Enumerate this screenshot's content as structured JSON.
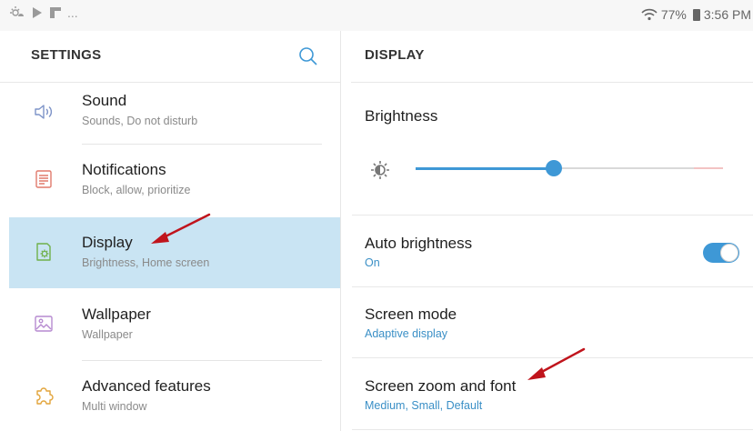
{
  "status_bar": {
    "left_icons": [
      "weather-icon",
      "play-store-icon",
      "flipboard-icon"
    ],
    "overflow": "...",
    "battery_percent": "77%",
    "time": "3:56 PM"
  },
  "left_panel": {
    "title": "SETTINGS",
    "items": [
      {
        "label": "Sound",
        "subtitle": "Sounds, Do not disturb",
        "icon": "speaker-icon"
      },
      {
        "label": "Notifications",
        "subtitle": "Block, allow, prioritize",
        "icon": "notifications-icon"
      },
      {
        "label": "Display",
        "subtitle": "Brightness, Home screen",
        "icon": "display-icon",
        "selected": true
      },
      {
        "label": "Wallpaper",
        "subtitle": "Wallpaper",
        "icon": "wallpaper-icon"
      },
      {
        "label": "Advanced features",
        "subtitle": "Multi window",
        "icon": "puzzle-icon"
      }
    ]
  },
  "right_panel": {
    "title": "DISPLAY",
    "brightness": {
      "label": "Brightness",
      "level_percent": 45
    },
    "auto_brightness": {
      "label": "Auto brightness",
      "value": "On",
      "enabled": true
    },
    "screen_mode": {
      "label": "Screen mode",
      "value": "Adaptive display"
    },
    "screen_zoom": {
      "label": "Screen zoom and font",
      "value": "Medium, Small, Default"
    }
  },
  "colors": {
    "accent": "#3e98d6",
    "selected_bg": "#c9e4f3",
    "annotation_arrow": "#c0141c"
  }
}
